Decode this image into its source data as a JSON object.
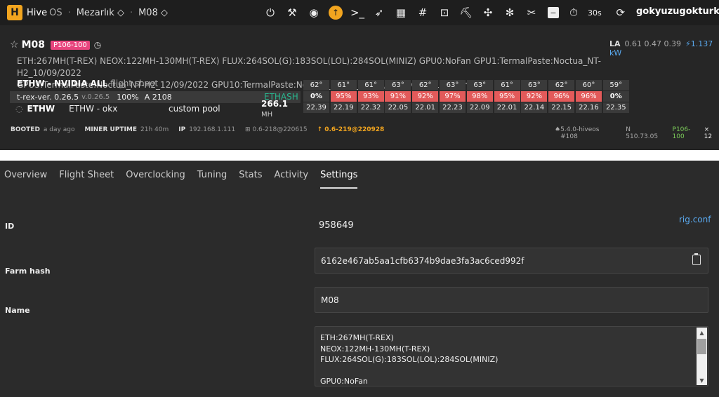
{
  "topbar": {
    "logo_text": "Hive",
    "logo_os": "OS",
    "farm": "Mezarlık ◇",
    "rig": "M08 ◇",
    "timer": "30s",
    "user": "gokyuzugokturk",
    "icons": [
      "power-icon",
      "wrench-icon",
      "globe-icon",
      "upgrade-icon",
      "terminal-icon",
      "rocket-icon",
      "dashboard-icon",
      "hash-icon",
      "shell-icon",
      "pickaxe-icon",
      "network-icon",
      "fan-icon",
      "tools-icon",
      "minus-icon",
      "stopwatch-icon",
      "refresh-icon"
    ]
  },
  "rig": {
    "name": "M08",
    "gpu_badge": "P106-100",
    "la_label": "LA",
    "la_values": "0.61 0.47 0.39",
    "power": "⚡1.137 kW",
    "description_line1": "ETH:267MH(T-REX) NEOX:122MH-130MH(T-REX) FLUX:264SOL(G):183SOL(LOL):284SOL(MINIZ) GPU0:NoFan GPU1:TermalPaste:Noctua_NT-H2_10/09/2022",
    "description_line2": "GPU3:TermalPaste:Noctua_NT-H2_12/09/2022 GPU10:TermalPaste:Noctua_NT-H2_10/09/2022 GPU11:NoFan",
    "flight_sheet_name": "ETHW - NVIDIA ALL",
    "flight_sheet_label": "flight sheet",
    "miner_name": "t-rex-ver. 0.26.5",
    "miner_version": "v.0.26.5",
    "miner_percent": "100%",
    "miner_accepted": "A 2108",
    "algo": "ETHASH",
    "coin": "ETHW",
    "wallet": "ETHW - okx",
    "pool": "custom pool",
    "hashrate": "266.1",
    "hashrate_unit": "MH",
    "gpus": [
      {
        "temp": "62°",
        "fan": "0%",
        "hr": "22.39",
        "hot": false
      },
      {
        "temp": "61°",
        "fan": "95%",
        "hr": "22.19",
        "hot": true
      },
      {
        "temp": "61°",
        "fan": "93%",
        "hr": "22.32",
        "hot": true
      },
      {
        "temp": "63°",
        "fan": "91%",
        "hr": "22.05",
        "hot": true
      },
      {
        "temp": "62°",
        "fan": "92%",
        "hr": "22.01",
        "hot": true
      },
      {
        "temp": "63°",
        "fan": "97%",
        "hr": "22.23",
        "hot": true
      },
      {
        "temp": "63°",
        "fan": "98%",
        "hr": "22.09",
        "hot": true
      },
      {
        "temp": "61°",
        "fan": "95%",
        "hr": "22.01",
        "hot": true
      },
      {
        "temp": "63°",
        "fan": "92%",
        "hr": "22.14",
        "hot": true
      },
      {
        "temp": "62°",
        "fan": "96%",
        "hr": "22.15",
        "hot": true
      },
      {
        "temp": "60°",
        "fan": "96%",
        "hr": "22.16",
        "hot": true
      },
      {
        "temp": "59°",
        "fan": "0%",
        "hr": "22.35",
        "hot": false
      }
    ],
    "booted_label": "BOOTED",
    "booted_value": "a day ago",
    "uptime_label": "MINER UPTIME",
    "uptime_value": "21h 40m",
    "ip_label": "IP",
    "ip_value": "192.168.1.111",
    "version": "0.6-218@220615",
    "update": "↑ 0.6-219@220928",
    "kernel": "5.4.0-hiveos #108",
    "driver": "N 510.73.05",
    "gpu_model": "P106-100",
    "gpu_count": "× 12"
  },
  "tabs": [
    "Overview",
    "Flight Sheet",
    "Overclocking",
    "Tuning",
    "Stats",
    "Activity",
    "Settings"
  ],
  "settings": {
    "id_label": "ID",
    "id_value": "958649",
    "rig_conf": "rig.conf",
    "farm_hash_label": "Farm hash",
    "farm_hash_value": "6162e467ab5aa1cfb6374b9dae3fa3ac6ced992f",
    "name_label": "Name",
    "name_value": "M08",
    "description_lines": [
      "ETH:267MH(T-REX)",
      "NEOX:122MH-130MH(T-REX)",
      "FLUX:264SOL(G):183SOL(LOL):284SOL(MINIZ)",
      "",
      "GPU0:NoFan"
    ]
  },
  "colors": {
    "accent": "#f2a51f",
    "link": "#5aaaf0",
    "hot_fan": "#e35a5a",
    "algo": "#29b58e",
    "badge": "#e8457e"
  }
}
